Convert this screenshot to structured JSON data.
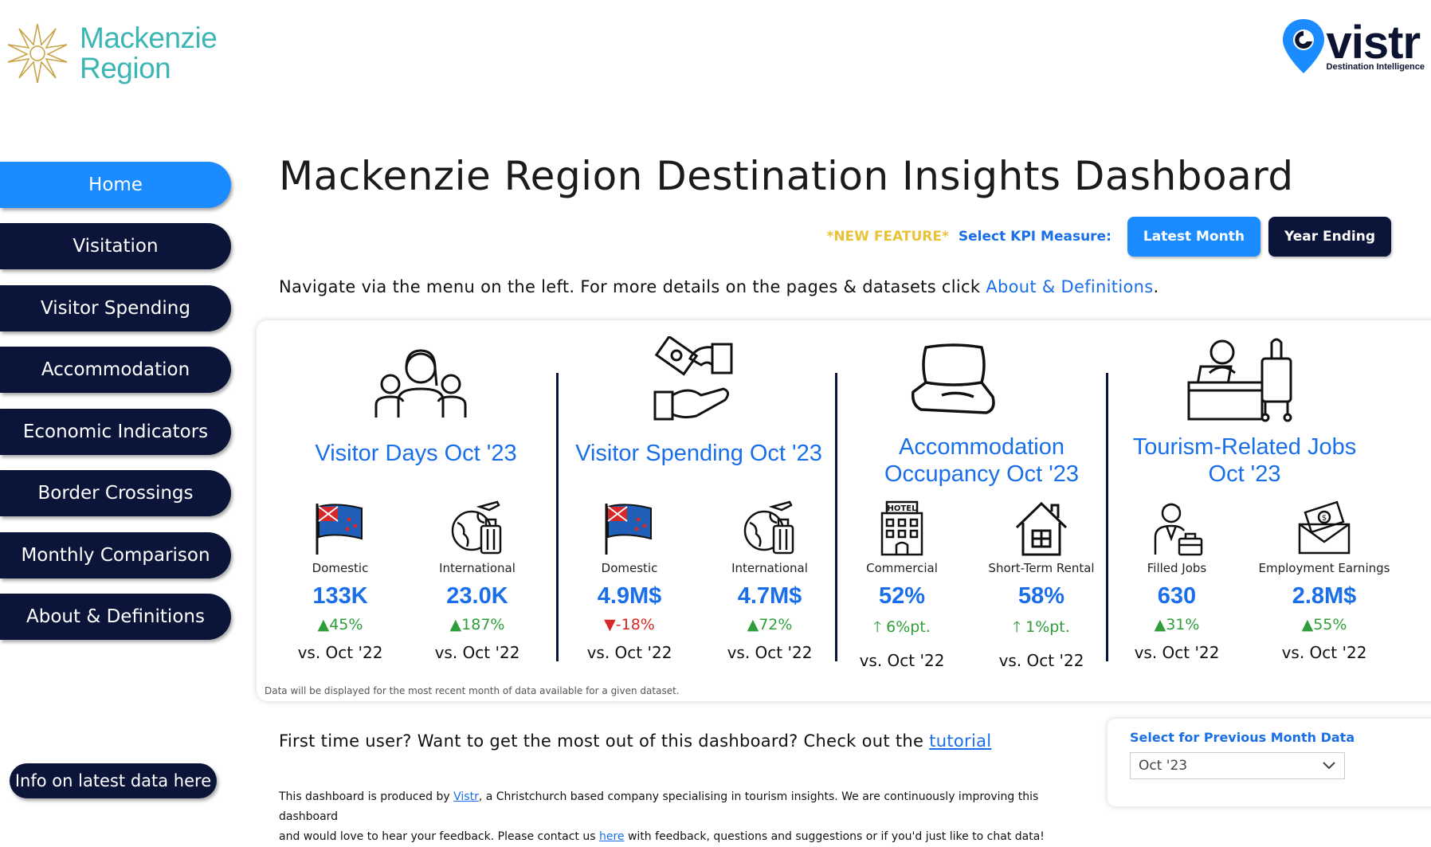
{
  "brand": {
    "line1": "Mackenzie",
    "line2": "Region"
  },
  "vistr": {
    "word": "vistr",
    "tagline": "Destination Intelligence"
  },
  "sidebar": {
    "items": [
      {
        "label": "Home",
        "active": true
      },
      {
        "label": "Visitation"
      },
      {
        "label": "Visitor Spending"
      },
      {
        "label": "Accommodation"
      },
      {
        "label": "Economic Indicators"
      },
      {
        "label": "Border Crossings"
      },
      {
        "label": "Monthly Comparison"
      },
      {
        "label": "About & Definitions"
      }
    ],
    "info_button": "Info on latest data here"
  },
  "header": {
    "title": "Mackenzie Region Destination Insights Dashboard",
    "new_feature": "*NEW FEATURE*",
    "kpi_label": "Select KPI Measure:",
    "kpi_latest": "Latest Month",
    "kpi_year": "Year Ending",
    "nav_text": "Navigate via the menu on the left. For more details on the pages & datasets click ",
    "nav_link": "About & Definitions",
    "nav_end": "."
  },
  "sections": [
    {
      "title": "Visitor Days Oct '23",
      "metrics": [
        {
          "label": "Domestic",
          "value": "133K",
          "change": "▲45%",
          "dir": "up",
          "vs": "vs. Oct '22"
        },
        {
          "label": "International",
          "value": "23.0K",
          "change": "▲187%",
          "dir": "up",
          "vs": "vs. Oct '22"
        }
      ]
    },
    {
      "title": "Visitor Spending Oct '23",
      "metrics": [
        {
          "label": "Domestic",
          "value": "4.9M$",
          "change": "▼-18%",
          "dir": "down",
          "vs": "vs. Oct '22"
        },
        {
          "label": "International",
          "value": "4.7M$",
          "change": "▲72%",
          "dir": "up",
          "vs": "vs. Oct '22"
        }
      ]
    },
    {
      "title_line1": "Accommodation",
      "title_line2": "Occupancy Oct '23",
      "metrics": [
        {
          "label": "Commercial",
          "value": "52%",
          "change": "🡑 6%pt.",
          "dir": "up",
          "vs": "vs. Oct '22"
        },
        {
          "label": "Short-Term Rental",
          "value": "58%",
          "change": "🡑 1%pt.",
          "dir": "up",
          "vs": "vs. Oct '22"
        }
      ]
    },
    {
      "title_line1": "Tourism-Related Jobs",
      "title_line2": "Oct '23",
      "metrics": [
        {
          "label": "Filled Jobs",
          "value": "630",
          "change": "▲31%",
          "dir": "up",
          "vs": "vs. Oct '22"
        },
        {
          "label": "Employment Earnings",
          "value": "2.8M$",
          "change": "▲55%",
          "dir": "up",
          "vs": "vs. Oct '22"
        }
      ]
    }
  ],
  "card_footnote": "Data will be displayed for the most recent month of data available for a given dataset.",
  "first_time": {
    "text": "First time user? Want to get the most out of this dashboard? Check out the ",
    "link": "tutorial"
  },
  "footer": {
    "p1": "This dashboard is produced by ",
    "vistr_link": "Vistr",
    "p2": ", a Christchurch based company specialising in tourism insights. We are continuously improving this dashboard",
    "p3": "and would love to hear your feedback. Please contact us ",
    "here_link": "here",
    "p4": " with feedback, questions and suggestions or if you'd just like to chat data!"
  },
  "prev_month": {
    "title": "Select for Previous Month Data",
    "value": "Oct '23"
  },
  "colors": {
    "accent": "#1a8cff",
    "navy": "#0b1539",
    "teal": "#3bb6b3",
    "up": "#2f9e3a",
    "down": "#d62828"
  }
}
